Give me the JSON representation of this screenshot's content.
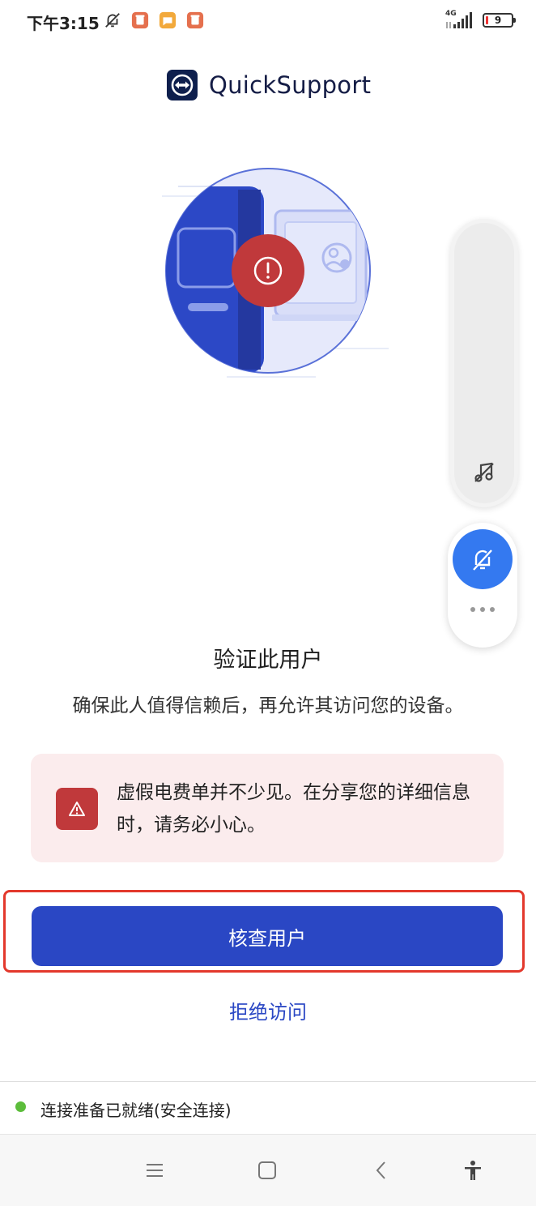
{
  "status_bar": {
    "time": "下午3:15",
    "network_label": "4G",
    "battery_level": "9",
    "icons": [
      "mute-icon",
      "app-notification-icon",
      "gallery-notification-icon",
      "app-notification-icon-2",
      "signal-icon",
      "battery-icon"
    ],
    "icon_colors": {
      "orange_red": "#e5704e",
      "yellow": "#f2a93b"
    }
  },
  "brand": {
    "name": "QuickSupport",
    "logo_color": "#0e1f4d"
  },
  "hero": {
    "icon": "warning-exclamation-icon",
    "accent": "#2c48c6",
    "alert_color": "#c0393b"
  },
  "floating_panel": {
    "icons": [
      "music-off-icon",
      "bell-off-icon",
      "more-icon"
    ],
    "bell_color": "#3479f0"
  },
  "main": {
    "heading": "验证此用户",
    "subtext": "确保此人值得信赖后，再允许其访问您的设备。"
  },
  "warning": {
    "text": "虚假电费单并不少见。在分享您的详细信息时，请务必小心。",
    "icon": "warning-triangle-icon",
    "color": "#c0393b",
    "background": "#fbeced"
  },
  "actions": {
    "primary_label": "核查用户",
    "primary_color": "#2a47c4",
    "secondary_label": "拒绝访问"
  },
  "connection": {
    "status_text": "连接准备已就绪(安全连接)",
    "status_color": "#5cbd3b"
  },
  "nav_bar": {
    "icons": [
      "menu-icon",
      "home-icon",
      "back-icon",
      "accessibility-icon"
    ]
  }
}
